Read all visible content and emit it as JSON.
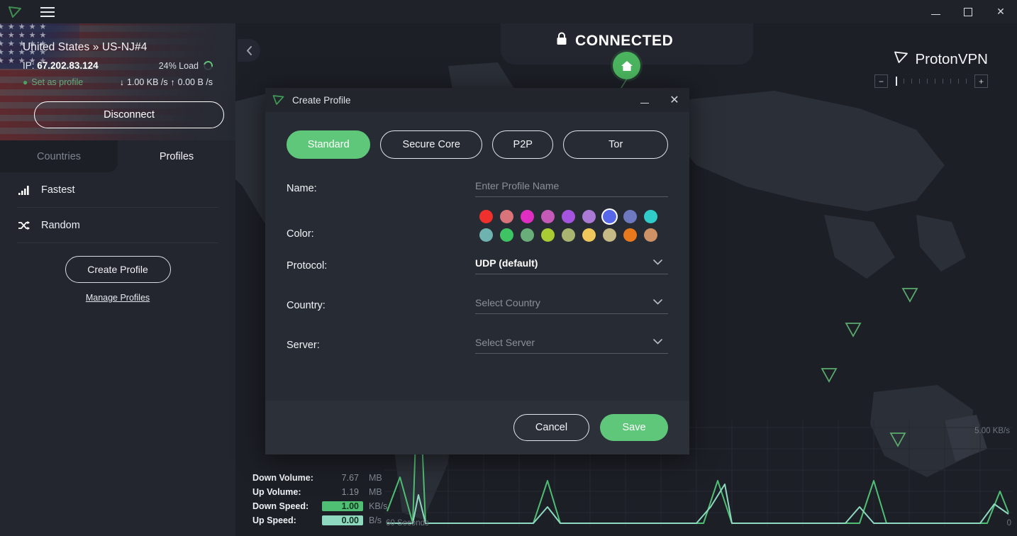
{
  "titlebar": {
    "logo_icon": "protonvpn-logo-icon",
    "menu_icon": "hamburger-menu-icon",
    "minimize_label": "",
    "maximize_label": "",
    "close_label": "✕"
  },
  "connection": {
    "location": "United States » US-NJ#4",
    "ip_label": "IP:",
    "ip_value": "67.202.83.124",
    "load": "24% Load",
    "set_as_profile": "Set as profile",
    "down_rate": "1.00 KB /s",
    "up_rate": "0.00 B /s",
    "down_arrow": "↓",
    "up_arrow": "↑",
    "disconnect_label": "Disconnect"
  },
  "sidebar": {
    "tabs": [
      {
        "label": "Countries",
        "active": false
      },
      {
        "label": "Profiles",
        "active": true
      }
    ],
    "profiles": [
      {
        "label": "Fastest",
        "icon": "signal-bars-icon"
      },
      {
        "label": "Random",
        "icon": "shuffle-icon"
      }
    ],
    "create_profile_label": "Create Profile",
    "manage_profiles_label": "Manage Profiles"
  },
  "map": {
    "status_text": "CONNECTED",
    "lock_icon": "lock-icon",
    "home_icon": "home-icon",
    "back_icon": "chevron-left-icon",
    "brand_name": "ProtonVPN",
    "brand_icon": "protonvpn-logo-icon",
    "zoom_minus": "−",
    "zoom_plus": "+",
    "zoom_ticks": 11,
    "zoom_active_index": 1
  },
  "stats": {
    "rows": [
      {
        "label": "Down Volume:",
        "value": "7.67",
        "unit": "MB",
        "highlight": "none"
      },
      {
        "label": "Up Volume:",
        "value": "1.19",
        "unit": "MB",
        "highlight": "none"
      },
      {
        "label": "Down Speed:",
        "value": "1.00",
        "unit": "KB/s",
        "highlight": "down"
      },
      {
        "label": "Up Speed:",
        "value": "0.00",
        "unit": "B/s",
        "highlight": "up"
      }
    ],
    "axis_left": "60 Seconds",
    "axis_right": "0",
    "scale_top": "5.00  KB/s"
  },
  "modal": {
    "title": "Create Profile",
    "icon": "protonvpn-logo-icon",
    "minimize_label": "",
    "close_label": "✕",
    "type_tabs": [
      {
        "label": "Standard",
        "active": true
      },
      {
        "label": "Secure Core",
        "active": false
      },
      {
        "label": "P2P",
        "active": false
      },
      {
        "label": "Tor",
        "active": false
      }
    ],
    "fields": {
      "name_label": "Name:",
      "name_placeholder": "Enter Profile Name",
      "name_value": "",
      "color_label": "Color:",
      "protocol_label": "Protocol:",
      "protocol_value": "UDP (default)",
      "country_label": "Country:",
      "country_placeholder": "Select Country",
      "server_label": "Server:",
      "server_placeholder": "Select Server"
    },
    "colors_row1": [
      "#f0302d",
      "#d9747a",
      "#e02ec2",
      "#c459b8",
      "#a554e0",
      "#ab7ad6",
      "#5566e8",
      "#6f79bf",
      "#30ccca"
    ],
    "colors_row2": [
      "#6fb3b0",
      "#3fc464",
      "#69ae7a",
      "#a9cc34",
      "#a8b470",
      "#efc85c",
      "#c5b985",
      "#e8791d",
      "#cf9166"
    ],
    "selected_color_index": 6,
    "cancel_label": "Cancel",
    "save_label": "Save",
    "accent_green": "#5fc77a"
  },
  "chart_data": {
    "type": "line",
    "title": "",
    "xlabel": "60 Seconds",
    "ylabel": "KB/s",
    "ylim": [
      0,
      5
    ],
    "xlim": [
      60,
      0
    ],
    "series": [
      {
        "name": "Down Speed",
        "values": [
          1.0,
          0.15,
          4.9,
          0.15,
          0.15,
          0.15,
          0.15,
          0.15,
          0.15,
          0.15,
          0.15,
          0.15,
          0.15,
          1.5,
          0.15,
          0.15,
          0.15,
          0.15,
          0.15,
          0.15,
          0.15,
          0.15,
          1.05,
          0.15,
          0.15,
          0.15,
          0.15,
          0.15,
          0.15,
          0.15,
          0.15,
          0.15,
          0.15,
          0.15,
          0.15,
          1.6,
          0.15,
          0.15,
          0.15,
          0.15,
          0.15,
          0.15,
          0.15,
          0.15,
          0.15,
          0.15,
          0.9,
          0.45
        ]
      },
      {
        "name": "Up Speed",
        "values": [
          0.15,
          0.15,
          0.9,
          0.15,
          0.15,
          0.15,
          0.15,
          0.15,
          0.15,
          0.15,
          0.15,
          0.15,
          0.15,
          0.95,
          0.15,
          0.15,
          0.15,
          0.15,
          0.15,
          0.15,
          0.15,
          0.15,
          1.5,
          0.15,
          0.15,
          0.15,
          0.15,
          0.15,
          0.15,
          0.15,
          0.15,
          0.8,
          0.15,
          0.15,
          0.15,
          0.15,
          0.15,
          0.15,
          0.15,
          0.15,
          0.15,
          0.15,
          0.15,
          0.15,
          0.15,
          0.15,
          0.15,
          0.55
        ]
      }
    ],
    "grid": true,
    "legend_position": "none"
  }
}
